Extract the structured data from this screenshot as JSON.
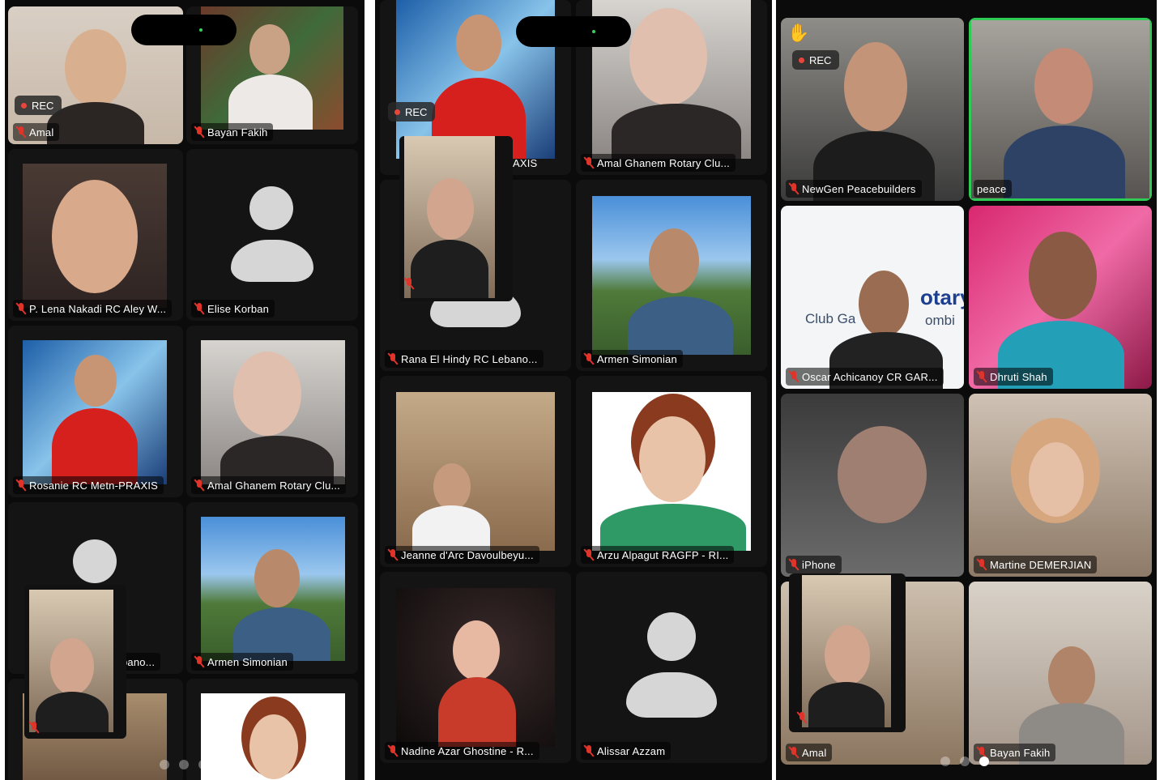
{
  "app": "Zoom",
  "recording_label": "REC",
  "screens": [
    {
      "tiles": [
        {
          "name": "Amal",
          "muted": true
        },
        {
          "name": "Bayan Fakih",
          "muted": true
        },
        {
          "name": "P. Lena Nakadi RC Aley W...",
          "muted": true
        },
        {
          "name": "Elise Korban",
          "muted": true
        },
        {
          "name": "Rosanie RC Metn-PRAXIS",
          "muted": true
        },
        {
          "name": "Amal Ghanem Rotary Clu...",
          "muted": true
        },
        {
          "name": "bano...",
          "muted": true
        },
        {
          "name": "Armen Simonian",
          "muted": true
        }
      ],
      "page_dots": 3,
      "active_page": 0
    },
    {
      "tiles": [
        {
          "name": "AXIS",
          "muted": true
        },
        {
          "name": "Amal Ghanem Rotary Clu...",
          "muted": true
        },
        {
          "name": "Rana El Hindy RC Lebano...",
          "muted": true
        },
        {
          "name": "Armen Simonian",
          "muted": true
        },
        {
          "name": "Jeanne d'Arc Davoulbeyu...",
          "muted": true
        },
        {
          "name": "Arzu Alpagut RAGFP - RI...",
          "muted": true
        },
        {
          "name": "Nadine Azar Ghostine - R...",
          "muted": true
        },
        {
          "name": "Alissar Azzam",
          "muted": true
        }
      ]
    },
    {
      "tiles": [
        {
          "name": "NewGen Peacebuilders",
          "muted": true,
          "hand_raised": true
        },
        {
          "name": "peace",
          "muted": false,
          "active_speaker": true
        },
        {
          "name": "Oscar Achicanoy CR GAR...",
          "muted": true
        },
        {
          "name": "Dhruti Shah",
          "muted": true
        },
        {
          "name": "iPhone",
          "muted": true
        },
        {
          "name": "Martine DEMERJIAN",
          "muted": true
        },
        {
          "name": "Amal",
          "muted": true
        },
        {
          "name": "Bayan Fakih",
          "muted": true
        }
      ],
      "background_text": {
        "club": "Club Ga",
        "rotary": "otary",
        "colombia": "ombi"
      },
      "page_dots": 3,
      "active_page": 2
    }
  ],
  "colors": {
    "active_speaker": "#2ecc55",
    "muted_mic": "#e0342a",
    "rec_dot": "#e8463b",
    "panel_bg": "#0b0b0b"
  }
}
